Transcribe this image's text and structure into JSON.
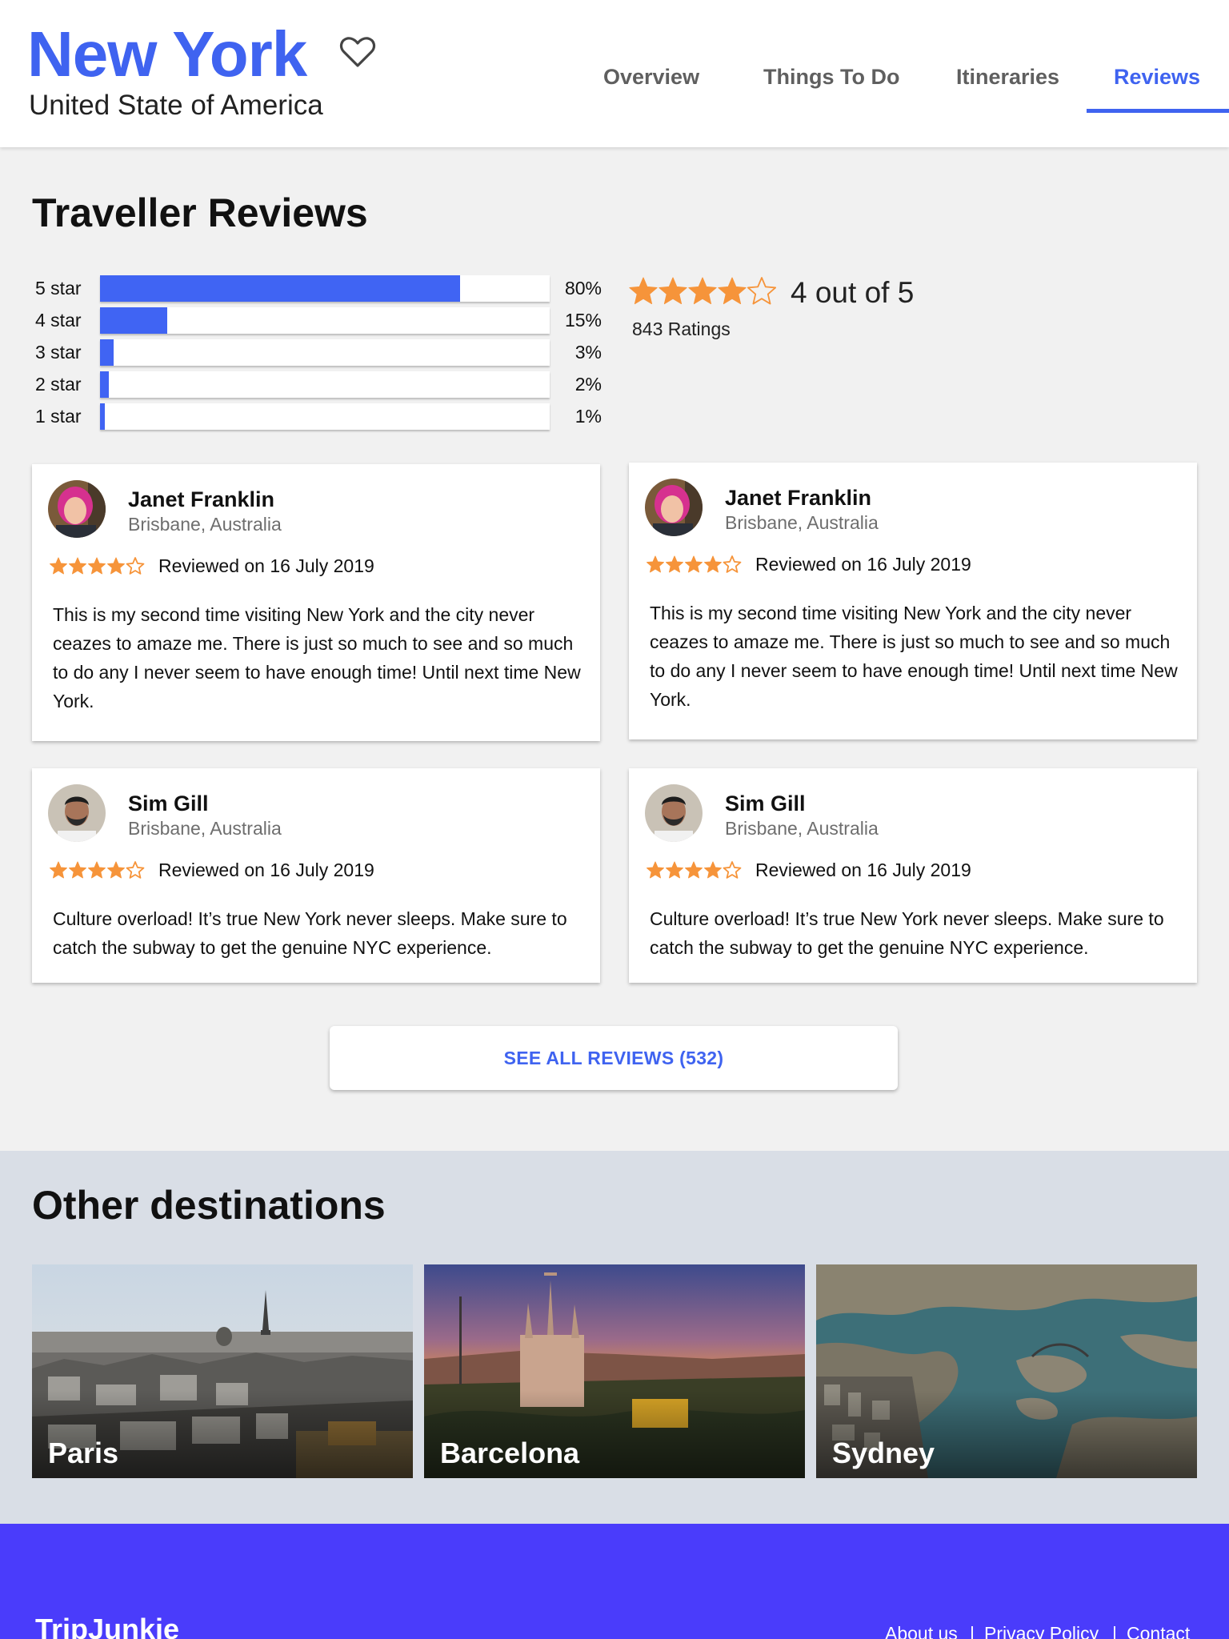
{
  "header": {
    "city": "New York",
    "country": "United State of America",
    "favorite_icon": "heart-outline-icon",
    "nav": [
      "Overview",
      "Things To Do",
      "Itineraries",
      "Reviews"
    ],
    "active_nav": "Reviews"
  },
  "reviews_section": {
    "title": "Traveller Reviews",
    "breakdown": [
      {
        "label": "5 star",
        "percent_text": "80%",
        "percent": 80
      },
      {
        "label": "4 star",
        "percent_text": "15%",
        "percent": 15
      },
      {
        "label": "3 star",
        "percent_text": "3%",
        "percent": 3
      },
      {
        "label": "2 star",
        "percent_text": "2%",
        "percent": 2
      },
      {
        "label": "1 star",
        "percent_text": "1%",
        "percent": 1
      }
    ],
    "overall_stars": 4,
    "max_stars": 5,
    "overall_text": "4 out of 5",
    "ratings_count": "843 Ratings",
    "reviews": [
      {
        "name": "Janet Franklin",
        "location": "Brisbane, Australia",
        "stars": 4,
        "date": "Reviewed on 16 July 2019",
        "body": "This is my second time visiting New York and the city never ceazes to amaze me. There is just so much to see and so much to do any I never seem to have enough time! Until next time New York.",
        "avatar": "female-avatar"
      },
      {
        "name": "Janet Franklin",
        "location": "Brisbane, Australia",
        "stars": 4,
        "date": "Reviewed on 16 July 2019",
        "body": "This is my second time visiting New York and the city never ceazes to amaze me. There is just so much to see and so much to do any I never seem to have enough time! Until next time New York.",
        "avatar": "female-avatar"
      },
      {
        "name": "Sim Gill",
        "location": "Brisbane, Australia",
        "stars": 4,
        "date": "Reviewed on 16 July 2019",
        "body": "Culture overload! It’s true New York never sleeps. Make sure to catch the subway to get the genuine NYC experience.",
        "avatar": "male-avatar"
      },
      {
        "name": "Sim Gill",
        "location": "Brisbane, Australia",
        "stars": 4,
        "date": "Reviewed on 16 July 2019",
        "body": "Culture overload! It’s true New York never sleeps. Make sure to catch the subway to get the genuine NYC experience.",
        "avatar": "male-avatar"
      }
    ],
    "see_all_label": "SEE ALL REVIEWS (532)"
  },
  "destinations": {
    "title": "Other destinations",
    "items": [
      {
        "name": "Paris"
      },
      {
        "name": "Barcelona"
      },
      {
        "name": "Sydney"
      }
    ]
  },
  "footer": {
    "brand": "TripJunkie",
    "links": [
      "About us",
      "Privacy Policy",
      "Contact"
    ],
    "separator": "|"
  },
  "colors": {
    "accent": "#3f63f0",
    "star": "#f6943a",
    "footer": "#4a3cfb",
    "destinations_bg": "#d9dee6"
  }
}
